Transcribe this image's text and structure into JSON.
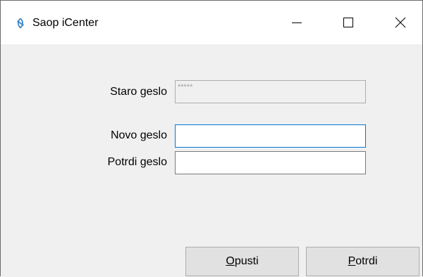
{
  "window": {
    "title": "Saop iCenter",
    "icon": "saop-logo-icon",
    "controls": {
      "minimize_icon": "minimize-icon",
      "maximize_icon": "maximize-icon",
      "close_icon": "close-icon"
    }
  },
  "form": {
    "old_password": {
      "label": "Staro geslo",
      "value": "*****",
      "disabled": true
    },
    "new_password": {
      "label": "Novo geslo",
      "value": ""
    },
    "confirm_password": {
      "label": "Potrdi geslo",
      "value": ""
    }
  },
  "buttons": {
    "cancel": {
      "accel": "O",
      "rest": "pusti"
    },
    "confirm": {
      "accel": "P",
      "rest": "otrdi"
    }
  },
  "colors": {
    "accent": "#0078d7",
    "logo": "#3a86c8"
  }
}
